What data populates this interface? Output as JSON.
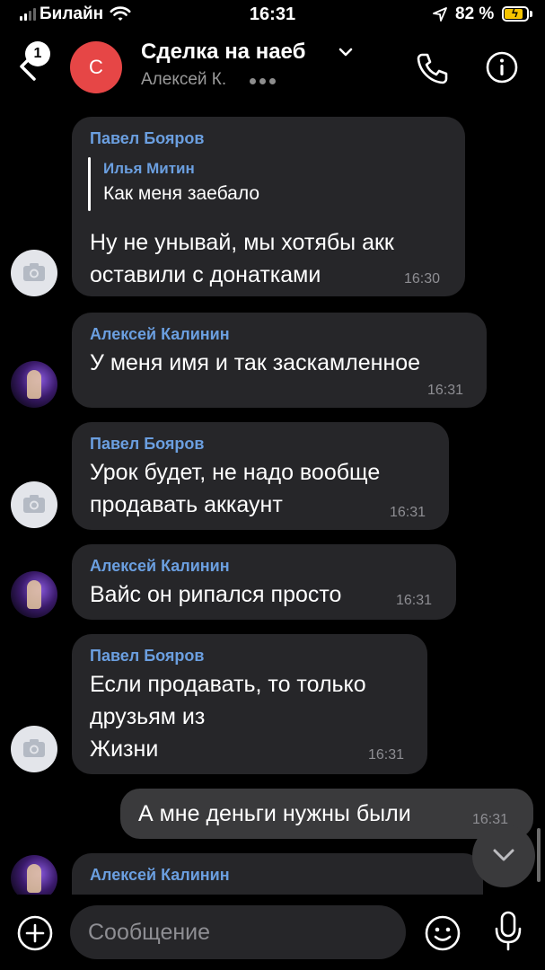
{
  "status_bar": {
    "carrier": "Билайн",
    "time": "16:31",
    "battery_percent": "82 %",
    "battery_level": 0.82,
    "battery_color": "#f5c400",
    "icons": [
      "signal-icon",
      "wifi-icon",
      "location-arrow-icon",
      "battery-charging-icon"
    ]
  },
  "header": {
    "back_badge": "1",
    "avatar_letter": "С",
    "avatar_color": "#e64646",
    "title": "Сделка на наеб",
    "subtitle": "Алексей К.",
    "icons": [
      "back-chevron-icon",
      "chevron-down-icon",
      "typing-dots-icon",
      "phone-icon",
      "info-icon"
    ]
  },
  "messages": [
    {
      "author": "Павел Бояров",
      "reply": {
        "author": "Илья Митин",
        "text": "Как меня заебало"
      },
      "lines": [
        "Ну не унывай, мы хотябы акк",
        "оставили с донатками"
      ],
      "time": "16:30",
      "avatar": "camera-icon"
    },
    {
      "author": "Алексей Калинин",
      "lines": [
        "У меня имя и так заскамленное"
      ],
      "time": "16:31",
      "avatar": "user-photo"
    },
    {
      "author": "Павел Бояров",
      "lines": [
        "Урок будет, не надо вообще",
        "продавать аккаунт"
      ],
      "time": "16:31",
      "avatar": "camera-icon"
    },
    {
      "author": "Алексей Калинин",
      "lines": [
        "Вайс он рипался просто"
      ],
      "time": "16:31",
      "avatar": "user-photo"
    },
    {
      "author": "Павел Бояров",
      "lines": [
        "Если продавать, то только",
        "друзьям из",
        "Жизни"
      ],
      "time": "16:31",
      "avatar": "camera-icon"
    },
    {
      "outgoing": true,
      "lines": [
        "А мне деньги нужны были"
      ],
      "time": "16:31"
    },
    {
      "author": "Алексей Калинин",
      "avatar": "user-photo"
    }
  ],
  "composer": {
    "placeholder": "Сообщение",
    "icons": [
      "plus-icon",
      "emoji-icon",
      "microphone-icon"
    ]
  },
  "colors": {
    "background": "#000000",
    "bubble_incoming": "#262629",
    "bubble_outgoing": "#3a3a3c",
    "author_name": "#6b9fe0",
    "timestamp": "#8e8e93"
  }
}
